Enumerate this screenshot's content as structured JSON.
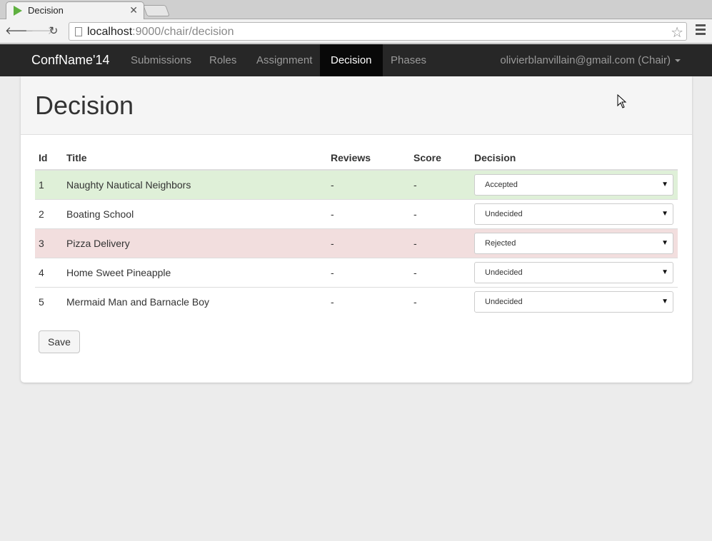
{
  "browser": {
    "tab_title": "Decision",
    "url_host": "localhost",
    "url_rest": ":9000/chair/decision"
  },
  "navbar": {
    "brand": "ConfName'14",
    "items": [
      {
        "label": "Submissions"
      },
      {
        "label": "Roles"
      },
      {
        "label": "Assignment"
      },
      {
        "label": "Decision"
      },
      {
        "label": "Phases"
      }
    ],
    "active_item": "Decision",
    "user": "olivierblanvillain@gmail.com (Chair)"
  },
  "page": {
    "title": "Decision"
  },
  "table": {
    "headers": {
      "id": "Id",
      "title": "Title",
      "reviews": "Reviews",
      "score": "Score",
      "decision": "Decision"
    },
    "rows": [
      {
        "id": "1",
        "title": "Naughty Nautical Neighbors",
        "reviews": "-",
        "score": "-",
        "decision": "Accepted"
      },
      {
        "id": "2",
        "title": "Boating School",
        "reviews": "-",
        "score": "-",
        "decision": "Undecided"
      },
      {
        "id": "3",
        "title": "Pizza Delivery",
        "reviews": "-",
        "score": "-",
        "decision": "Rejected"
      },
      {
        "id": "4",
        "title": "Home Sweet Pineapple",
        "reviews": "-",
        "score": "-",
        "decision": "Undecided"
      },
      {
        "id": "5",
        "title": "Mermaid Man and Barnacle Boy",
        "reviews": "-",
        "score": "-",
        "decision": "Undecided"
      }
    ]
  },
  "actions": {
    "save_label": "Save"
  },
  "colors": {
    "accepted_row": "#dff0d8",
    "rejected_row": "#f2dede",
    "navbar_bg": "#272727",
    "navbar_active": "#080808"
  },
  "icons": {
    "back": "back-arrow-icon",
    "forward": "forward-arrow-icon",
    "reload": "reload-icon",
    "bookmark": "star-icon",
    "menu": "hamburger-menu-icon"
  }
}
